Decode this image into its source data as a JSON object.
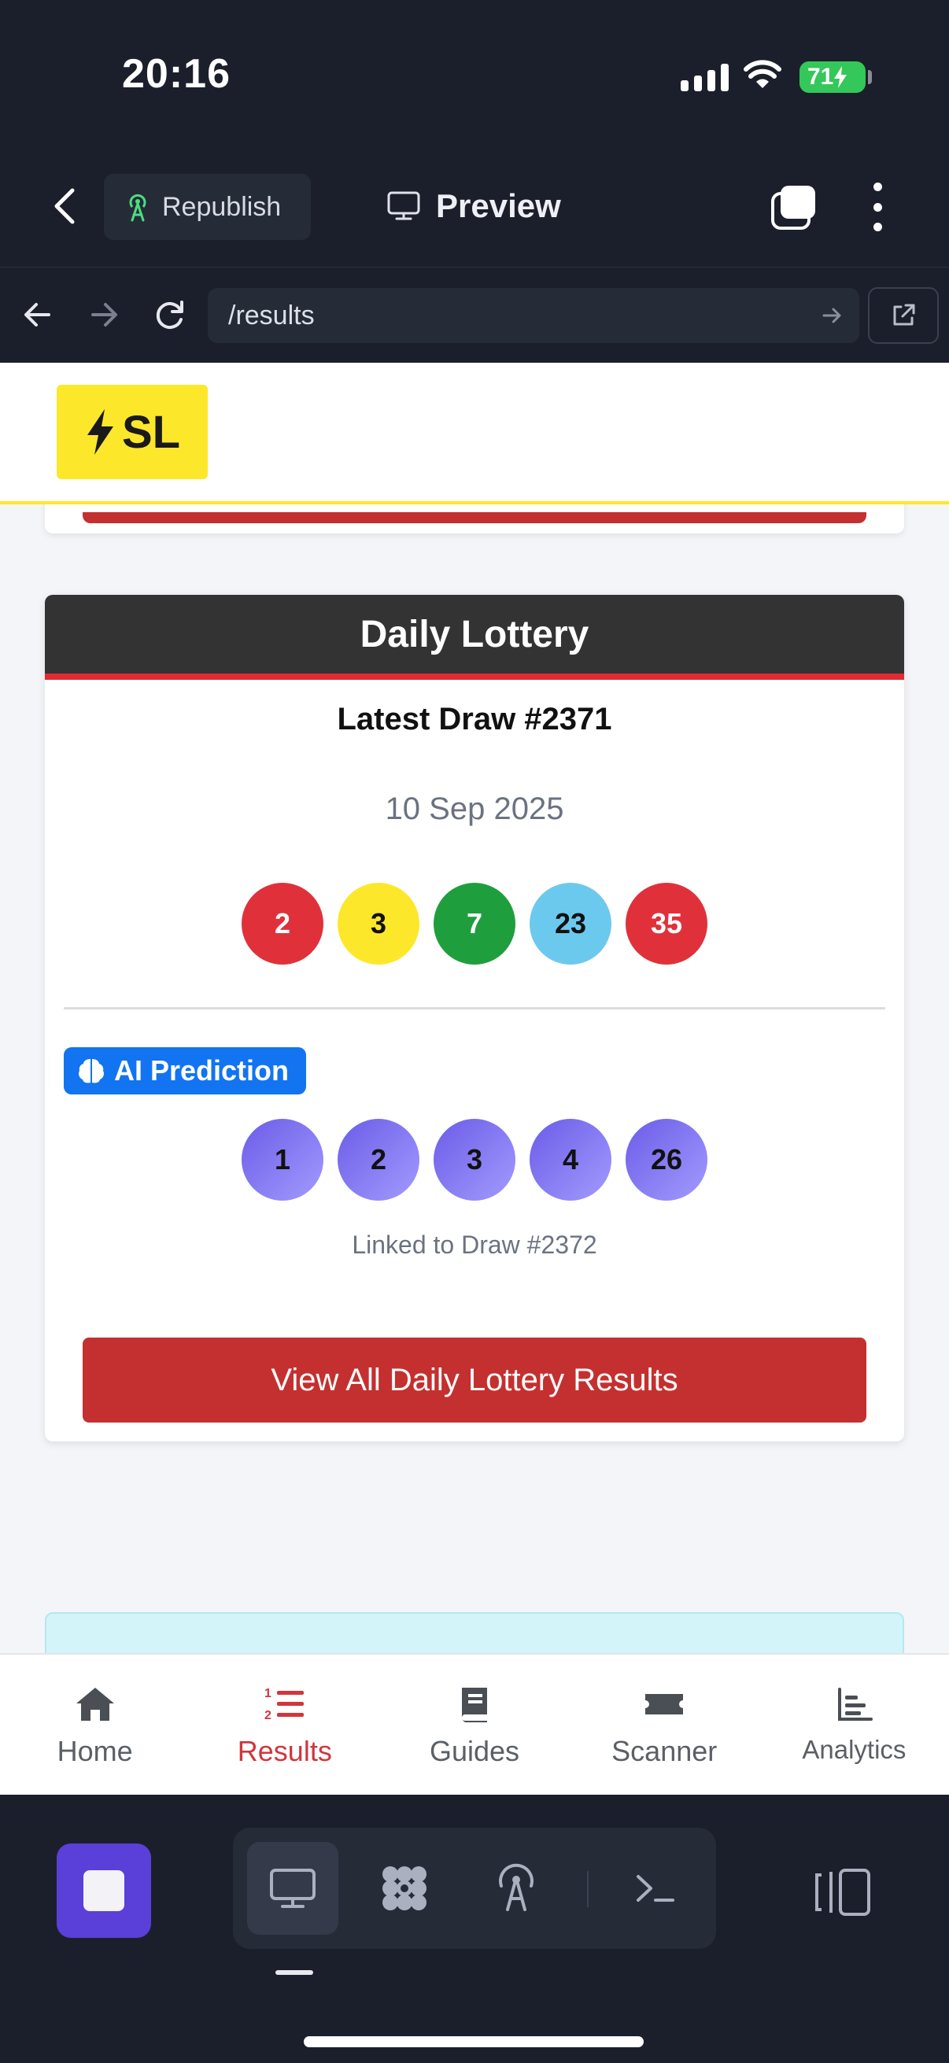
{
  "status_bar": {
    "time": "20:16",
    "battery": "71"
  },
  "editor_toolbar": {
    "republish_label": "Republish",
    "preview_label": "Preview"
  },
  "url_bar": {
    "url": "/results"
  },
  "site": {
    "logo_text": "SL"
  },
  "lottery_card": {
    "title": "Daily Lottery",
    "draw_title": "Latest Draw #2371",
    "draw_date": "10 Sep 2025",
    "numbers": [
      {
        "value": "2",
        "color": "#e0313b"
      },
      {
        "value": "3",
        "color": "#fde72b"
      },
      {
        "value": "7",
        "color": "#1f9e3e"
      },
      {
        "value": "23",
        "color": "#6cc9ee"
      },
      {
        "value": "35",
        "color": "#e0313b"
      }
    ],
    "ai_badge_label": "AI Prediction",
    "prediction_numbers": [
      "1",
      "2",
      "3",
      "4",
      "26"
    ],
    "linked_text": "Linked to Draw #2372",
    "view_all_label": "View All Daily Lottery Results"
  },
  "bottom_nav": {
    "active": "Results",
    "items": [
      "Home",
      "Results",
      "Guides",
      "Scanner",
      "Analytics"
    ]
  },
  "colors": {
    "accent_red": "#c4302f",
    "accent_yellow": "#fde72b",
    "ai_blue": "#1274f0",
    "prediction_purple": "#7a6ae8",
    "stop_purple": "#5b3fd9"
  },
  "icons": {
    "back": "chevron-left-icon",
    "republish": "antenna-icon",
    "preview": "monitor-icon",
    "tabs": "tabs-icon",
    "menu": "kebab-icon",
    "ai": "brain-icon"
  }
}
